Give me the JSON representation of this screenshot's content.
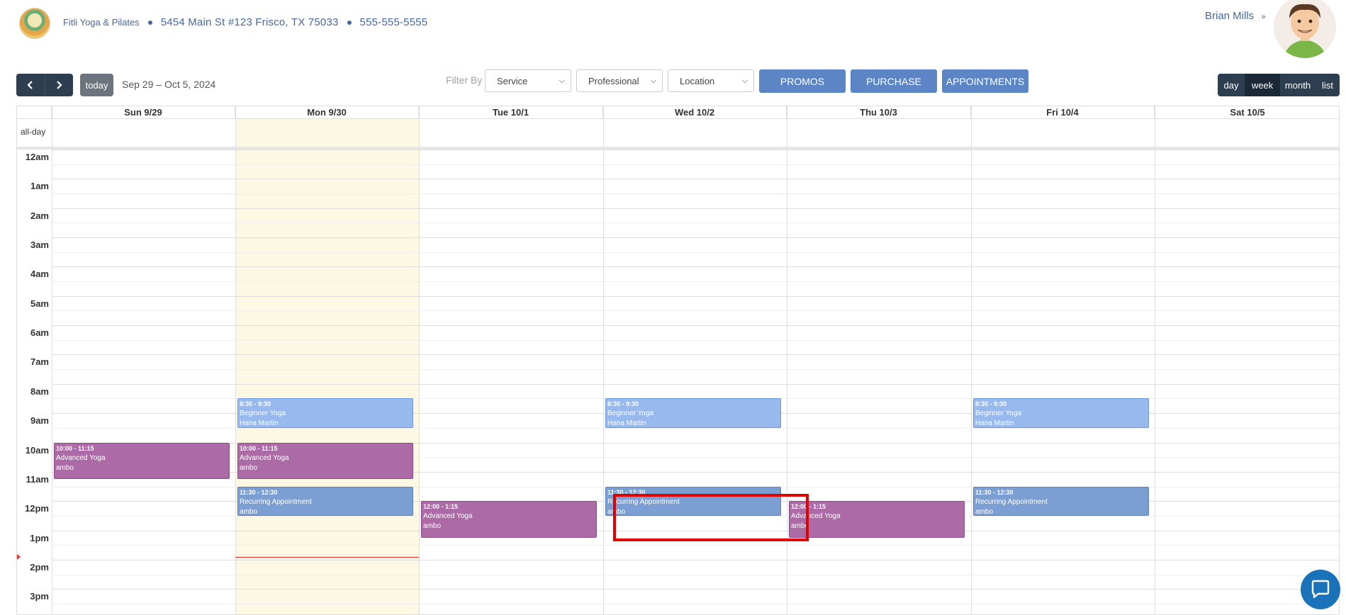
{
  "header": {
    "business_name": "Fitli Yoga & Pilates",
    "address": "5454 Main St #123 Frisco, TX 75033",
    "phone": "555-555-5555",
    "user_name": "Brian Mills"
  },
  "toolbar": {
    "today_label": "today",
    "date_range": "Sep 29 – Oct 5, 2024",
    "filter_label": "Filter By",
    "filters": [
      "Service",
      "Professional",
      "Location"
    ],
    "actions": [
      "PROMOS",
      "PURCHASE",
      "APPOINTMENTS"
    ],
    "views": [
      "day",
      "week",
      "month",
      "list"
    ],
    "active_view": "week"
  },
  "calendar": {
    "days": [
      "Sun 9/29",
      "Mon 9/30",
      "Tue 10/1",
      "Wed 10/2",
      "Thu 10/3",
      "Fri 10/4",
      "Sat 10/5"
    ],
    "today_index": 1,
    "allday_label": "all-day",
    "hours": [
      "12am",
      "1am",
      "2am",
      "3am",
      "4am",
      "5am",
      "6am",
      "7am",
      "8am",
      "9am",
      "10am",
      "11am",
      "12pm",
      "1pm",
      "2pm",
      "3pm"
    ],
    "events": [
      {
        "day": 1,
        "start": 8.5,
        "end": 9.5,
        "time": "8:30 - 9:30",
        "title": "Beginner Yoga",
        "who": "Hana Martin",
        "kind": "beginner"
      },
      {
        "day": 3,
        "start": 8.5,
        "end": 9.5,
        "time": "8:30 - 9:30",
        "title": "Beginner Yoga",
        "who": "Hana Martin",
        "kind": "beginner"
      },
      {
        "day": 5,
        "start": 8.5,
        "end": 9.5,
        "time": "8:30 - 9:30",
        "title": "Beginner Yoga",
        "who": "Hana Martin",
        "kind": "beginner"
      },
      {
        "day": 0,
        "start": 10,
        "end": 11.25,
        "time": "10:00 - 11:15",
        "title": "Advanced Yoga",
        "who": "ambo",
        "kind": "advanced"
      },
      {
        "day": 1,
        "start": 10,
        "end": 11.25,
        "time": "10:00 - 11:15",
        "title": "Advanced Yoga",
        "who": "ambo",
        "kind": "advanced"
      },
      {
        "day": 1,
        "start": 11.5,
        "end": 12.5,
        "time": "11:30 - 12:30",
        "title": "Recurring Appointment",
        "who": "ambo",
        "kind": "recurring"
      },
      {
        "day": 3,
        "start": 11.5,
        "end": 12.5,
        "time": "11:30 - 12:30",
        "title": "Recurring Appointment",
        "who": "ambo",
        "kind": "recurring"
      },
      {
        "day": 5,
        "start": 11.5,
        "end": 12.5,
        "time": "11:30 - 12:30",
        "title": "Recurring Appointment",
        "who": "ambo",
        "kind": "recurring"
      },
      {
        "day": 2,
        "start": 12,
        "end": 13.25,
        "time": "12:00 - 1:15",
        "title": "Advanced Yoga",
        "who": "ambo",
        "kind": "advanced"
      },
      {
        "day": 4,
        "start": 12,
        "end": 13.25,
        "time": "12:00 - 1:15",
        "title": "Advanced Yoga",
        "who": "ambo",
        "kind": "advanced"
      }
    ]
  },
  "colors": {
    "nav_dark": "#2c3e50",
    "action_blue": "#5b85c5",
    "beginner": "#98b9ee",
    "advanced": "#ac6ba7",
    "recurring": "#7c9fd3",
    "today_bg": "#fcf8e3",
    "highlight": "#e00000"
  }
}
